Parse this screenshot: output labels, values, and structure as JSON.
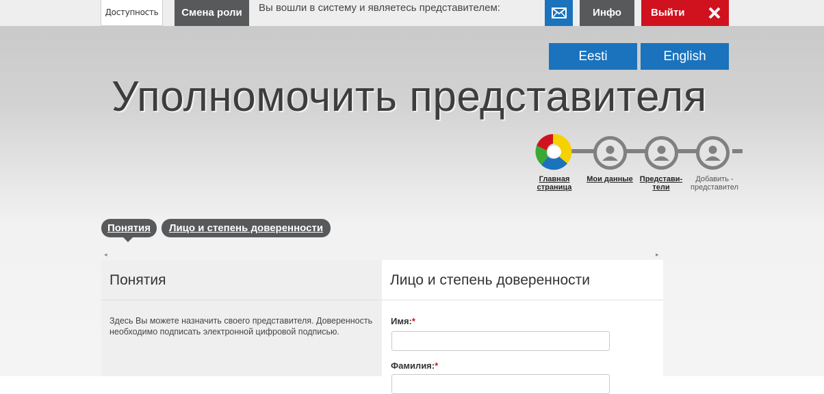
{
  "topbar": {
    "accessibility": "Доступность",
    "change_role": "Смена роли",
    "login_status": "Вы вошли в систему и являетесь представителем:",
    "mail_icon": "envelope-icon",
    "info": "Инфо",
    "logout": "Выйти",
    "close_icon": "close-icon"
  },
  "languages": {
    "et": "Eesti",
    "en": "English"
  },
  "page_title": "Уполномочить представителя",
  "steps": [
    {
      "line1": "Главная",
      "line2": "страница"
    },
    {
      "line1": "Мои данные",
      "line2": ""
    },
    {
      "line1": "Представи-",
      "line2": "тели"
    },
    {
      "line1": "Добавить -",
      "line2": "представител"
    }
  ],
  "tabs": [
    {
      "label": "Понятия"
    },
    {
      "label": "Лицо и степень доверенности"
    }
  ],
  "scroll": {
    "left": "◂",
    "right": "▸"
  },
  "left_panel": {
    "title": "Понятия",
    "text": "Здесь Вы можете назначить своего представителя. Доверенность необходимо подписать электронной цифровой подписью."
  },
  "right_panel": {
    "title": "Лицо и степень доверенности",
    "fields": [
      {
        "label": "Имя:",
        "required": "*",
        "value": ""
      },
      {
        "label": "Фамилия:",
        "required": "*",
        "value": ""
      }
    ]
  },
  "colors": {
    "blue": "#1a73bc",
    "red": "#d0121f",
    "dark": "#58595b"
  }
}
